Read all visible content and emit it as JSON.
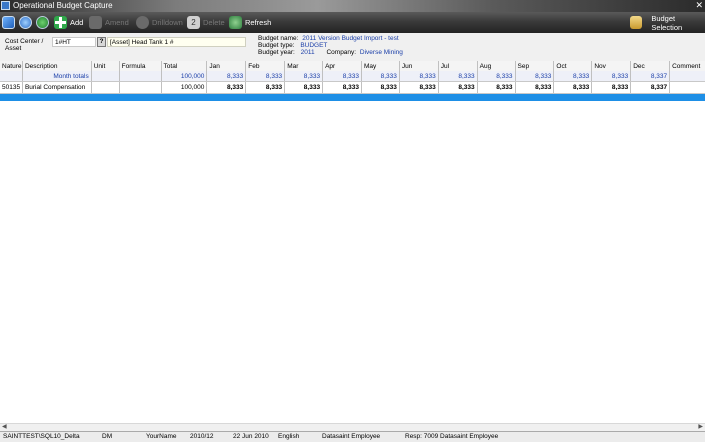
{
  "window": {
    "title": "Operational Budget Capture",
    "close_glyph": "✕"
  },
  "toolbar": {
    "add_label": "Add",
    "amend_label": "Amend",
    "drilldown_label": "Drilldown",
    "delete_label": "Delete",
    "refresh_label": "Refresh",
    "budget_selection_label": "Budget Selection"
  },
  "header": {
    "cost_center_label": "Cost Center  /",
    "asset_label": "Asset",
    "code_value": "1#HT",
    "help_glyph": "?",
    "asset_description": "[Asset]  Head Tank 1 #",
    "budget_name_label": "Budget name:",
    "budget_name_value": "2011 Version Budget Import - test",
    "budget_type_label": "Budget type:",
    "budget_type_value": "BUDGET",
    "budget_year_label": "Budget year:",
    "budget_year_value": "2011",
    "company_label": "Company:",
    "company_value": "Diverse Mining"
  },
  "grid": {
    "columns": [
      "Nature",
      "Description",
      "Unit",
      "Formula",
      "Total",
      "Jan",
      "Feb",
      "Mar",
      "Apr",
      "May",
      "Jun",
      "Jul",
      "Aug",
      "Sep",
      "Oct",
      "Nov",
      "Dec",
      "Comment"
    ],
    "totals_row": {
      "label": "Month totals",
      "total": "100,000",
      "months": [
        "8,333",
        "8,333",
        "8,333",
        "8,333",
        "8,333",
        "8,333",
        "8,333",
        "8,333",
        "8,333",
        "8,333",
        "8,333",
        "8,337"
      ]
    },
    "rows": [
      {
        "nature": "50135",
        "description": "Burial Compensation",
        "unit": "",
        "formula": "",
        "total": "100,000",
        "months": [
          "8,333",
          "8,333",
          "8,333",
          "8,333",
          "8,333",
          "8,333",
          "8,333",
          "8,333",
          "8,333",
          "8,333",
          "8,333",
          "8,337"
        ],
        "comment": ""
      }
    ]
  },
  "statusbar": {
    "server": "SAINTTEST\\SQL10_Delta",
    "db": "DM",
    "user": "YourName",
    "period": "2010/12",
    "date": "22 Jun 2010",
    "language": "English",
    "role": "Datasaint Employee",
    "resp": "Resp: 7009 Datasaint Employee"
  },
  "colors": {
    "accent_blue": "#1e8fe6",
    "value_blue": "#1a3ea8",
    "toolbar_dark": "#2b2b2b"
  }
}
